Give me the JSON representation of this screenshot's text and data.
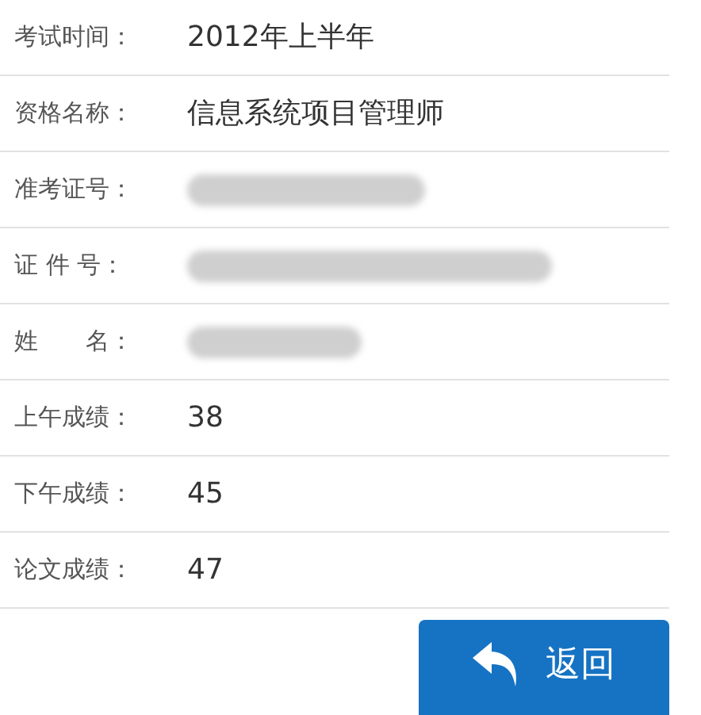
{
  "rows": [
    {
      "label": "考试时间：",
      "kind": "text",
      "value": "2012年上半年"
    },
    {
      "label": "资格名称：",
      "kind": "text",
      "value": "信息系统项目管理师"
    },
    {
      "label": "准考证号：",
      "kind": "redacted"
    },
    {
      "label": "证 件 号：",
      "kind": "redacted"
    },
    {
      "label": "姓　　名：",
      "kind": "redacted"
    },
    {
      "label": "上午成绩：",
      "kind": "text",
      "value": "38"
    },
    {
      "label": "下午成绩：",
      "kind": "text",
      "value": "45"
    },
    {
      "label": "论文成绩：",
      "kind": "text",
      "value": "47"
    }
  ],
  "back_button": {
    "label": "返回"
  }
}
